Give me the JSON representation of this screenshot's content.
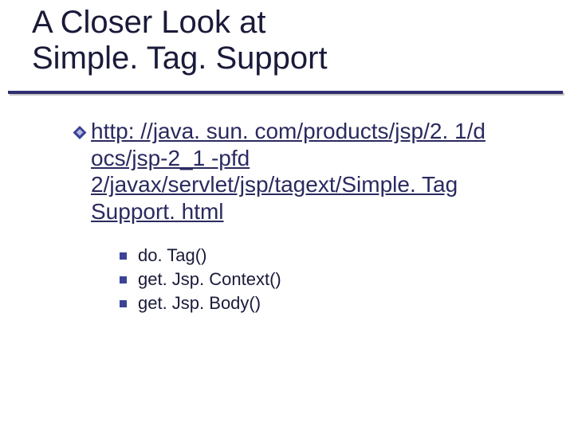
{
  "title_line1": "A Closer Look at",
  "title_line2": "Simple. Tag. Support",
  "link": {
    "text": "http: //java. sun. com/products/jsp/2. 1/d ocs/jsp-2_1 -pfd 2/javax/servlet/jsp/tagext/Simple. Tag Support. html"
  },
  "methods": [
    {
      "label": "do. Tag()"
    },
    {
      "label": "get. Jsp. Context()"
    },
    {
      "label": "get. Jsp. Body()"
    }
  ]
}
